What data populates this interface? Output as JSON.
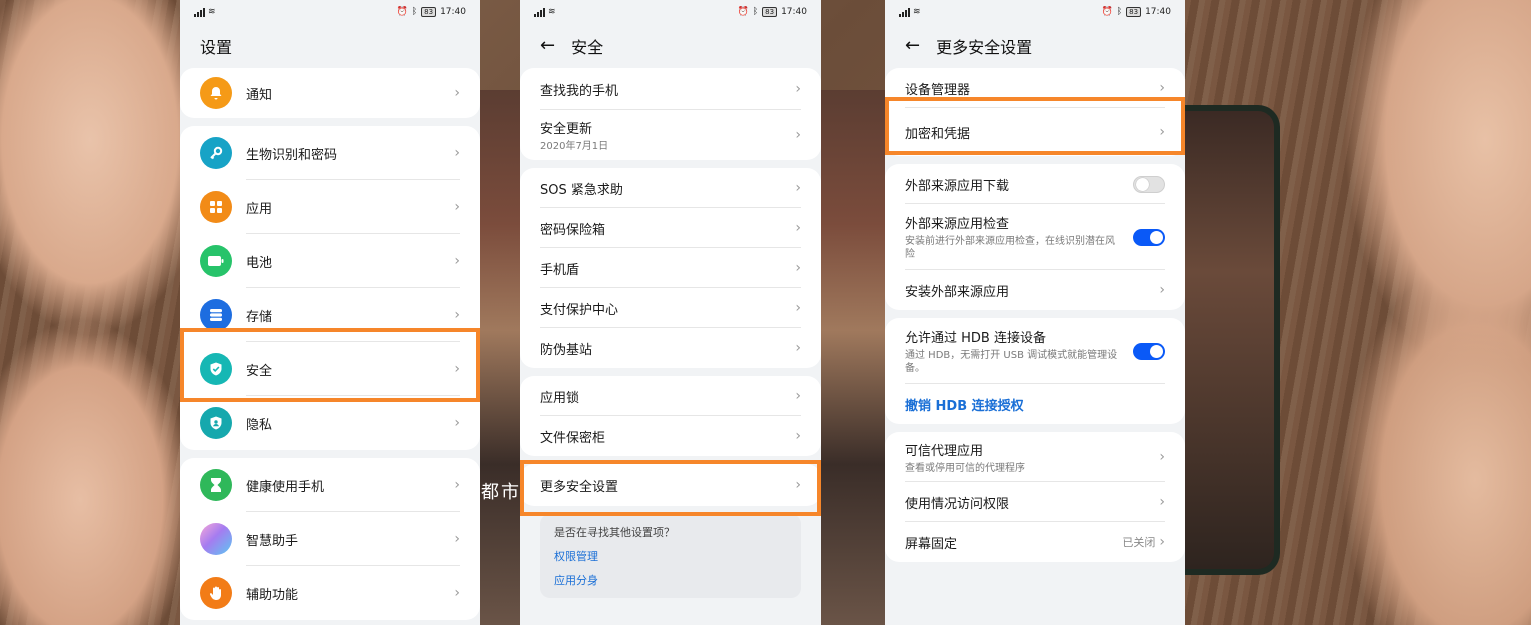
{
  "status": {
    "time": "17:40",
    "battery": "83",
    "wifi": "≋"
  },
  "background": {
    "caption": "都市"
  },
  "settings": {
    "title": "设置",
    "group1": [
      {
        "label": "通知",
        "icon": "bell-icon"
      }
    ],
    "group2": [
      {
        "label": "生物识别和密码",
        "icon": "key-icon"
      },
      {
        "label": "应用",
        "icon": "apps-grid-icon"
      },
      {
        "label": "电池",
        "icon": "battery-icon"
      },
      {
        "label": "存储",
        "icon": "storage-icon"
      },
      {
        "label": "安全",
        "icon": "shield-check-icon"
      },
      {
        "label": "隐私",
        "icon": "privacy-icon"
      }
    ],
    "group3": [
      {
        "label": "健康使用手机",
        "icon": "hourglass-icon"
      },
      {
        "label": "智慧助手",
        "icon": "assistant-icon"
      },
      {
        "label": "辅助功能",
        "icon": "hand-icon"
      }
    ],
    "highlighted": "安全"
  },
  "security": {
    "title": "安全",
    "group1": [
      {
        "label": "查找我的手机"
      },
      {
        "label": "安全更新",
        "sub": "2020年7月1日"
      }
    ],
    "group2": [
      {
        "label": "SOS 紧急求助"
      },
      {
        "label": "密码保险箱"
      },
      {
        "label": "手机盾"
      },
      {
        "label": "支付保护中心"
      },
      {
        "label": "防伪基站"
      }
    ],
    "group3": [
      {
        "label": "应用锁"
      },
      {
        "label": "文件保密柜"
      }
    ],
    "group4": [
      {
        "label": "更多安全设置"
      }
    ],
    "suggest": {
      "question": "是否在寻找其他设置项？",
      "links": [
        "权限管理",
        "应用分身"
      ]
    },
    "highlighted": "更多安全设置"
  },
  "more": {
    "title": "更多安全设置",
    "group1": [
      {
        "label": "设备管理器"
      },
      {
        "label": "加密和凭据"
      }
    ],
    "group2": [
      {
        "label": "外部来源应用下载",
        "toggle": "off"
      },
      {
        "label": "外部来源应用检查",
        "sub": "安装前进行外部来源应用检查，在线识别潜在风险",
        "toggle": "on"
      },
      {
        "label": "安装外部来源应用"
      }
    ],
    "group3": [
      {
        "label": "允许通过 HDB 连接设备",
        "sub": "通过 HDB，无需打开 USB 调试模式就能管理设备。",
        "toggle": "on"
      },
      {
        "label": "撤销 HDB 连接授权",
        "link": true
      }
    ],
    "group4": [
      {
        "label": "可信代理应用",
        "sub": "查看或停用可信的代理程序"
      },
      {
        "label": "使用情况访问权限"
      },
      {
        "label": "屏幕固定",
        "trailing": "已关闭"
      }
    ],
    "highlighted": "加密和凭据"
  },
  "colors": {
    "accent": "#0a59f7",
    "highlight": "#f6862a",
    "link": "#1a6fd6"
  }
}
